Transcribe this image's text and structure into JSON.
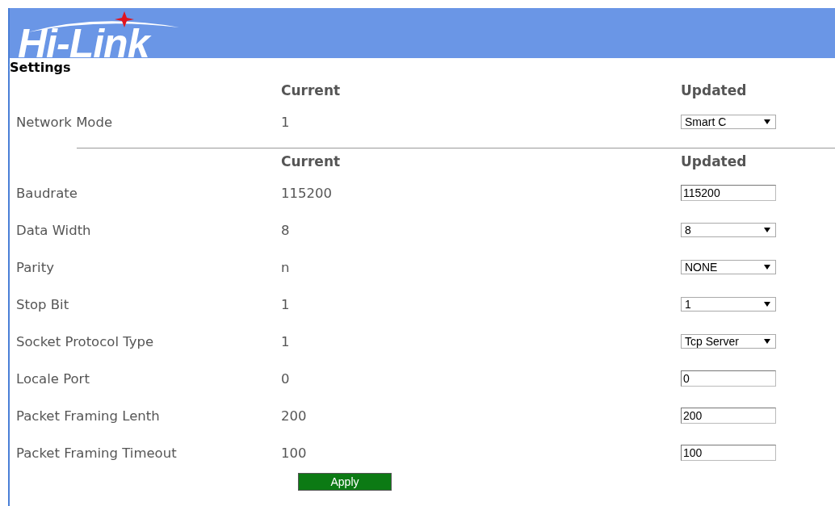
{
  "header": {
    "logo": "Hi-Link"
  },
  "page_title": "Settings",
  "sections": [
    {
      "columns": {
        "current": "Current",
        "updated": "Updated"
      },
      "rows": [
        {
          "label": "Network Mode",
          "current": "1",
          "kind": "select",
          "value": "Smart C"
        }
      ]
    },
    {
      "columns": {
        "current": "Current",
        "updated": "Updated"
      },
      "rows": [
        {
          "label": "Baudrate",
          "current": "115200",
          "kind": "text",
          "value": "115200"
        },
        {
          "label": "Data Width",
          "current": "8",
          "kind": "select",
          "value": "8"
        },
        {
          "label": "Parity",
          "current": "n",
          "kind": "select",
          "value": "NONE"
        },
        {
          "label": "Stop Bit",
          "current": "1",
          "kind": "select",
          "value": "1"
        },
        {
          "label": "Socket Protocol Type",
          "current": "1",
          "kind": "select",
          "value": "Tcp Server"
        },
        {
          "label": "Locale Port",
          "current": "0",
          "kind": "text",
          "value": "0"
        },
        {
          "label": "Packet Framing Lenth",
          "current": "200",
          "kind": "text",
          "value": "200"
        },
        {
          "label": "Packet Framing Timeout",
          "current": "100",
          "kind": "text",
          "value": "100"
        }
      ]
    }
  ],
  "apply_button": "Apply"
}
